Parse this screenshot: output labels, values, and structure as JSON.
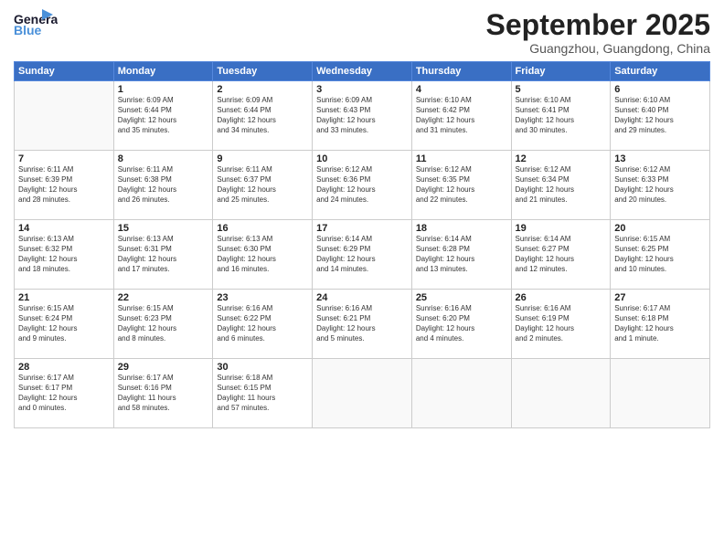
{
  "header": {
    "logo_general": "General",
    "logo_blue": "Blue",
    "month": "September 2025",
    "location": "Guangzhou, Guangdong, China"
  },
  "weekdays": [
    "Sunday",
    "Monday",
    "Tuesday",
    "Wednesday",
    "Thursday",
    "Friday",
    "Saturday"
  ],
  "weeks": [
    [
      {
        "day": "",
        "info": ""
      },
      {
        "day": "1",
        "info": "Sunrise: 6:09 AM\nSunset: 6:44 PM\nDaylight: 12 hours\nand 35 minutes."
      },
      {
        "day": "2",
        "info": "Sunrise: 6:09 AM\nSunset: 6:44 PM\nDaylight: 12 hours\nand 34 minutes."
      },
      {
        "day": "3",
        "info": "Sunrise: 6:09 AM\nSunset: 6:43 PM\nDaylight: 12 hours\nand 33 minutes."
      },
      {
        "day": "4",
        "info": "Sunrise: 6:10 AM\nSunset: 6:42 PM\nDaylight: 12 hours\nand 31 minutes."
      },
      {
        "day": "5",
        "info": "Sunrise: 6:10 AM\nSunset: 6:41 PM\nDaylight: 12 hours\nand 30 minutes."
      },
      {
        "day": "6",
        "info": "Sunrise: 6:10 AM\nSunset: 6:40 PM\nDaylight: 12 hours\nand 29 minutes."
      }
    ],
    [
      {
        "day": "7",
        "info": "Sunrise: 6:11 AM\nSunset: 6:39 PM\nDaylight: 12 hours\nand 28 minutes."
      },
      {
        "day": "8",
        "info": "Sunrise: 6:11 AM\nSunset: 6:38 PM\nDaylight: 12 hours\nand 26 minutes."
      },
      {
        "day": "9",
        "info": "Sunrise: 6:11 AM\nSunset: 6:37 PM\nDaylight: 12 hours\nand 25 minutes."
      },
      {
        "day": "10",
        "info": "Sunrise: 6:12 AM\nSunset: 6:36 PM\nDaylight: 12 hours\nand 24 minutes."
      },
      {
        "day": "11",
        "info": "Sunrise: 6:12 AM\nSunset: 6:35 PM\nDaylight: 12 hours\nand 22 minutes."
      },
      {
        "day": "12",
        "info": "Sunrise: 6:12 AM\nSunset: 6:34 PM\nDaylight: 12 hours\nand 21 minutes."
      },
      {
        "day": "13",
        "info": "Sunrise: 6:12 AM\nSunset: 6:33 PM\nDaylight: 12 hours\nand 20 minutes."
      }
    ],
    [
      {
        "day": "14",
        "info": "Sunrise: 6:13 AM\nSunset: 6:32 PM\nDaylight: 12 hours\nand 18 minutes."
      },
      {
        "day": "15",
        "info": "Sunrise: 6:13 AM\nSunset: 6:31 PM\nDaylight: 12 hours\nand 17 minutes."
      },
      {
        "day": "16",
        "info": "Sunrise: 6:13 AM\nSunset: 6:30 PM\nDaylight: 12 hours\nand 16 minutes."
      },
      {
        "day": "17",
        "info": "Sunrise: 6:14 AM\nSunset: 6:29 PM\nDaylight: 12 hours\nand 14 minutes."
      },
      {
        "day": "18",
        "info": "Sunrise: 6:14 AM\nSunset: 6:28 PM\nDaylight: 12 hours\nand 13 minutes."
      },
      {
        "day": "19",
        "info": "Sunrise: 6:14 AM\nSunset: 6:27 PM\nDaylight: 12 hours\nand 12 minutes."
      },
      {
        "day": "20",
        "info": "Sunrise: 6:15 AM\nSunset: 6:25 PM\nDaylight: 12 hours\nand 10 minutes."
      }
    ],
    [
      {
        "day": "21",
        "info": "Sunrise: 6:15 AM\nSunset: 6:24 PM\nDaylight: 12 hours\nand 9 minutes."
      },
      {
        "day": "22",
        "info": "Sunrise: 6:15 AM\nSunset: 6:23 PM\nDaylight: 12 hours\nand 8 minutes."
      },
      {
        "day": "23",
        "info": "Sunrise: 6:16 AM\nSunset: 6:22 PM\nDaylight: 12 hours\nand 6 minutes."
      },
      {
        "day": "24",
        "info": "Sunrise: 6:16 AM\nSunset: 6:21 PM\nDaylight: 12 hours\nand 5 minutes."
      },
      {
        "day": "25",
        "info": "Sunrise: 6:16 AM\nSunset: 6:20 PM\nDaylight: 12 hours\nand 4 minutes."
      },
      {
        "day": "26",
        "info": "Sunrise: 6:16 AM\nSunset: 6:19 PM\nDaylight: 12 hours\nand 2 minutes."
      },
      {
        "day": "27",
        "info": "Sunrise: 6:17 AM\nSunset: 6:18 PM\nDaylight: 12 hours\nand 1 minute."
      }
    ],
    [
      {
        "day": "28",
        "info": "Sunrise: 6:17 AM\nSunset: 6:17 PM\nDaylight: 12 hours\nand 0 minutes."
      },
      {
        "day": "29",
        "info": "Sunrise: 6:17 AM\nSunset: 6:16 PM\nDaylight: 11 hours\nand 58 minutes."
      },
      {
        "day": "30",
        "info": "Sunrise: 6:18 AM\nSunset: 6:15 PM\nDaylight: 11 hours\nand 57 minutes."
      },
      {
        "day": "",
        "info": ""
      },
      {
        "day": "",
        "info": ""
      },
      {
        "day": "",
        "info": ""
      },
      {
        "day": "",
        "info": ""
      }
    ]
  ]
}
